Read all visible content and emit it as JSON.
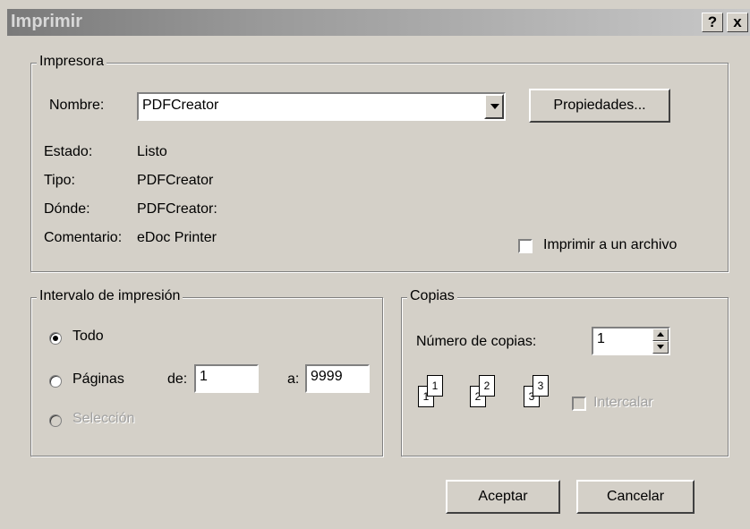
{
  "window": {
    "title": "Imprimir",
    "help_label": "?",
    "close_label": "x"
  },
  "printer": {
    "legend": "Impresora",
    "name_label": "Nombre:",
    "name_value": "PDFCreator",
    "properties_label": "Propiedades...",
    "status_label": "Estado:",
    "status_value": "Listo",
    "type_label": "Tipo:",
    "type_value": "PDFCreator",
    "where_label": "Dónde:",
    "where_value": "PDFCreator:",
    "comment_label": "Comentario:",
    "comment_value": "eDoc Printer",
    "print_to_file_label": "Imprimir a un archivo",
    "print_to_file_checked": false
  },
  "range": {
    "legend": "Intervalo de impresión",
    "all_label": "Todo",
    "pages_label": "Páginas",
    "from_label": "de:",
    "from_value": "1",
    "to_label": "a:",
    "to_value": "9999",
    "selection_label": "Selección",
    "selected": "Todo"
  },
  "copies": {
    "legend": "Copias",
    "count_label": "Número de copias:",
    "count_value": "1",
    "collate_label": "Intercalar",
    "collate_checked": false,
    "collate_pages": [
      "1",
      "1",
      "2",
      "2",
      "3",
      "3"
    ]
  },
  "actions": {
    "ok_label": "Aceptar",
    "cancel_label": "Cancelar"
  }
}
